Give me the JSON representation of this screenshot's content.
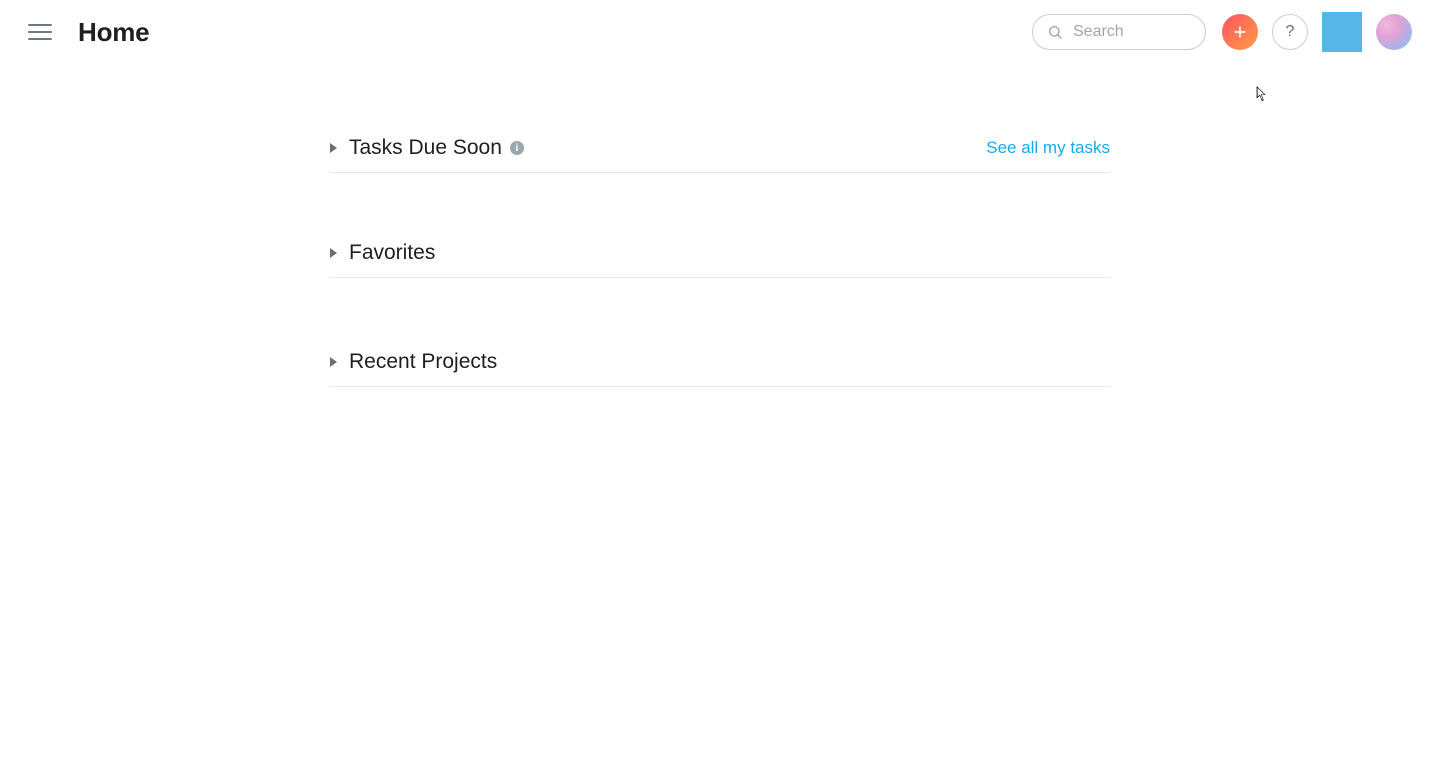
{
  "header": {
    "page_title": "Home",
    "search_placeholder": "Search",
    "help_glyph": "?",
    "info_glyph": "i"
  },
  "sections": [
    {
      "title": "Tasks Due Soon",
      "info": true,
      "link": "See all my tasks"
    },
    {
      "title": "Favorites"
    },
    {
      "title": "Recent Projects"
    }
  ]
}
